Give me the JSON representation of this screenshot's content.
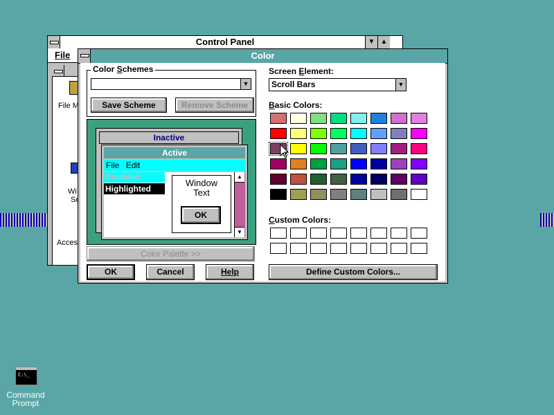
{
  "control_panel": {
    "title": "Control Panel",
    "menu_file": "File",
    "icons": [
      {
        "label": "File M"
      },
      {
        "label": "Wi"
      },
      {
        "label": "Se"
      },
      {
        "label": "Acces"
      }
    ]
  },
  "dialog": {
    "title": "Color",
    "color_schemes_label": "Color Schemes",
    "color_schemes_value": "",
    "save_scheme": "Save Scheme",
    "remove_scheme": "Remove Scheme",
    "preview": {
      "inactive_title": "Inactive",
      "active_title": "Active",
      "menu_file": "File",
      "menu_edit": "Edit",
      "disabled_text": "Disabled",
      "highlighted_text": "Highlighted",
      "window_text": "Window\nText",
      "ok": "OK"
    },
    "color_palette_btn": "Color Palette >>",
    "ok": "OK",
    "cancel": "Cancel",
    "help": "Help",
    "screen_element_label": "Screen Element:",
    "screen_element_value": "Scroll Bars",
    "basic_colors_label": "Basic Colors:",
    "custom_colors_label": "Custom Colors:",
    "define_custom": "Define Custom Colors...",
    "basic_colors": [
      [
        "#d47070",
        "#ffffe0",
        "#80e080",
        "#00e080",
        "#80f0f0",
        "#2080e0",
        "#d070d0",
        "#e080e0"
      ],
      [
        "#ff0000",
        "#ffff80",
        "#80ff00",
        "#00ff60",
        "#00ffff",
        "#60a0ff",
        "#8080c0",
        "#ff00ff"
      ],
      [
        "#804060",
        "#ffff00",
        "#00ff00",
        "#50a0a0",
        "#4060c0",
        "#8080ff",
        "#a02080",
        "#ff0080"
      ],
      [
        "#a00060",
        "#e08020",
        "#00a040",
        "#20a080",
        "#0000ff",
        "#0000a0",
        "#a040c0",
        "#8000ff"
      ],
      [
        "#600030",
        "#c05040",
        "#206030",
        "#406040",
        "#0000a0",
        "#000060",
        "#600060",
        "#6000c0"
      ],
      [
        "#000000",
        "#a0a050",
        "#909060",
        "#808080",
        "#608080",
        "#c0c0c0",
        "#707070",
        "#ffffff"
      ]
    ],
    "selected_basic_color": "#804060"
  },
  "desktop": {
    "command_prompt_label": "Command\nPrompt",
    "command_prompt_icon_text": "C:\\_"
  }
}
